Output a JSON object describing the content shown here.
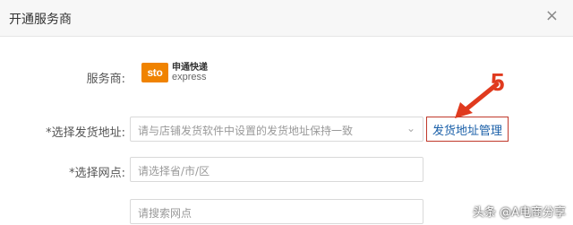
{
  "dialog": {
    "title": "开通服务商",
    "close_glyph": "×"
  },
  "labels": {
    "provider": "服务商:",
    "address": "*选择发货地址:",
    "outlet": "*选择网点:"
  },
  "provider_logo": {
    "mark": "sto",
    "name_cn": "申通快递",
    "name_en": "express"
  },
  "fields": {
    "address_placeholder": "请与店铺发货软件中设置的发货地址保持一致",
    "region_placeholder": "请选择省/市/区",
    "search_placeholder": "请搜索网点"
  },
  "buttons": {
    "address_management": "发货地址管理"
  },
  "annotation": {
    "number": "5",
    "color": "#e03a1e"
  },
  "watermark": "头条 @A电商分享"
}
